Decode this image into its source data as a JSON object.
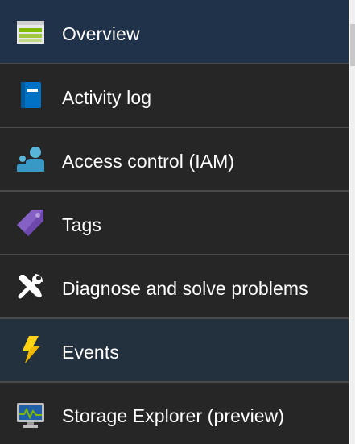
{
  "menu": {
    "items": [
      {
        "label": "Overview",
        "icon": "overview-icon",
        "state": "selected"
      },
      {
        "label": "Activity log",
        "icon": "activity-log-icon",
        "state": "normal"
      },
      {
        "label": "Access control (IAM)",
        "icon": "access-control-icon",
        "state": "normal"
      },
      {
        "label": "Tags",
        "icon": "tag-icon",
        "state": "normal"
      },
      {
        "label": "Diagnose and solve problems",
        "icon": "wrench-screwdriver-icon",
        "state": "normal"
      },
      {
        "label": "Events",
        "icon": "lightning-icon",
        "state": "hover"
      },
      {
        "label": "Storage Explorer (preview)",
        "icon": "storage-explorer-icon",
        "state": "normal"
      }
    ]
  },
  "colors": {
    "background": "#262626",
    "selected": "#1f3249",
    "hover": "#23303e",
    "divider": "#4a4a4a",
    "text": "#ffffff"
  }
}
